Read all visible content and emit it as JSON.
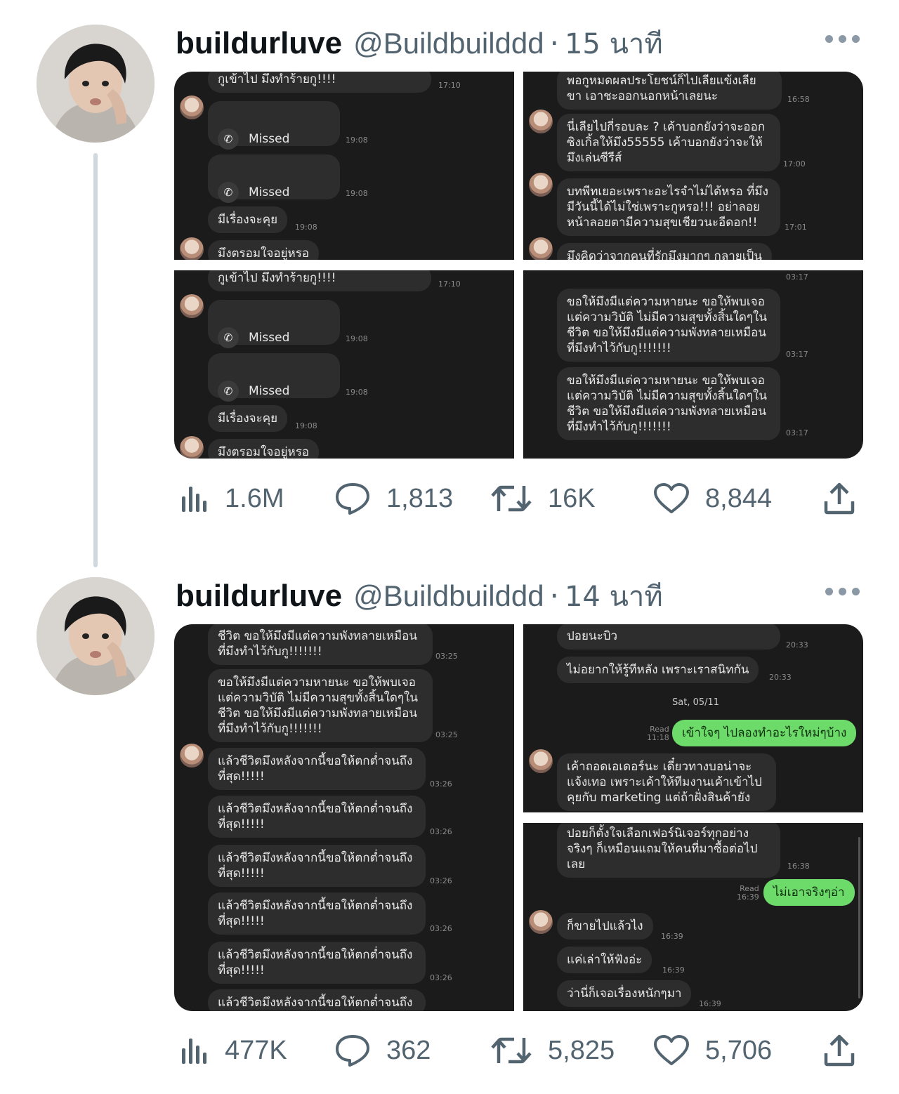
{
  "tweets": [
    {
      "name": "buildurluve",
      "handle": "@Buildbuilddd",
      "separator": "·",
      "time": "15 นาที",
      "avatar_icon": "profile-photo",
      "stats": {
        "views": "1.6M",
        "replies": "1,813",
        "retweets": "16K",
        "likes": "8,844"
      },
      "panels": {
        "top_left": {
          "bubble1": "กูเข้าไป มึงทำร้ายกู!!!!",
          "ts1": "17:10",
          "call1": "Missed",
          "ts2": "19:08",
          "call2": "Missed",
          "ts3": "19:08",
          "bubble2": "มีเรื่องจะคุย",
          "ts4": "19:08",
          "bubble3": "มึงตรอมใจอยู่หรอ"
        },
        "top_right": {
          "bubble1": "พอกูหมดผลประโยชน์ก็ไปเลียแข้งเลีย\nขา เอาชะออกนอกหน้าเลยนะ",
          "ts1": "16:58",
          "bubble2": "นี่เลียไปกี่รอบละ ? เค้าบอกยังว่าจะออก\nซิงเกิ้ลให้มึง55555 เค้าบอกยังว่าจะให้\nมึงเล่นซีรีส์",
          "ts2": "17:00",
          "bubble3": "บทพีทเยอะเพราะอะไรจำไม่ได้หรอ ที่มึง\nมีวันนี้ได้ไม่ใช่เพราะกูหรอ!!! อย่าลอย\nหน้าลอยตามีความสุขเชียวนะอีดอก!!",
          "ts3": "17:01",
          "bubble4": "มึงคิดว่าจากคนที่รักมึงมากๆ กลายเป็น"
        },
        "bottom_left": {
          "bubble1": "กูเข้าไป มึงทำร้ายกู!!!!",
          "ts1": "17:10",
          "call1": "Missed",
          "ts2": "19:08",
          "call2": "Missed",
          "ts3": "19:08",
          "bubble2": "มีเรื่องจะคุย",
          "ts4": "19:08",
          "bubble3": "มึงตรอมใจอยู่หรอ"
        },
        "bottom_right": {
          "ts0": "03:17",
          "bubble1": "ขอให้มึงมีแต่ความหายนะ ขอให้พบเจอ\nแต่ความวิบัติ ไม่มีความสุขทั้งสิ้นใดๆใน\nชีวิต ขอให้มึงมีแต่ความพังทลายเหมือน\nที่มึงทำไว้กับกู!!!!!!!",
          "ts1": "03:17",
          "bubble2": "ขอให้มึงมีแต่ความหายนะ ขอให้พบเจอ\nแต่ความวิบัติ ไม่มีความสุขทั้งสิ้นใดๆใน\nชีวิต ขอให้มึงมีแต่ความพังทลายเหมือน\nที่มึงทำไว้กับกู!!!!!!!",
          "ts2": "03:17"
        }
      }
    },
    {
      "name": "buildurluve",
      "handle": "@Buildbuilddd",
      "separator": "·",
      "time": "14 นาที",
      "avatar_icon": "profile-photo",
      "stats": {
        "views": "477K",
        "replies": "362",
        "retweets": "5,825",
        "likes": "5,706"
      },
      "panels": {
        "left": {
          "bubble1": "ชีวิต ขอให้มึงมีแต่ความพังทลายเหมือน\nที่มึงทำไว้กับกู!!!!!!!",
          "ts1": "03:25",
          "bubble2": "ขอให้มึงมีแต่ความหายนะ ขอให้พบเจอ\nแต่ความวิบัติ ไม่มีความสุขทั้งสิ้นใดๆใน\nชีวิต ขอให้มึงมีแต่ความพังทลายเหมือน\nที่มึงทำไว้กับกู!!!!!!!",
          "ts2": "03:25",
          "curse": "แล้วชีวิตมึงหลังจากนี้ขอให้ตกต่ำจนถึง\nที่สุด!!!!!",
          "ts_curse": "03:26",
          "last": "แล้วชีวิตมึงหลังจากนี้ขอให้ตกต่ำจนถึง"
        },
        "right_top": {
          "bubble1": "ปอยนะบิว",
          "ts1": "20:33",
          "bubble2": "ไม่อยากให้รู้ทีหลัง เพราะเราสนิทกัน",
          "ts2": "20:33",
          "date": "Sat, 05/11",
          "read": "Read\n11:18",
          "green1": "เข้าใจๆ ไปลองทำอะไรใหม่ๆบ้าง",
          "bubble3": "เค้าถอดเอเดอร์นะ เดี๋ยวทางบอน่าจะ\nแจ้งเทอ เพราะเค้าให้ทีมงานเค้าเข้าไป\nคุยกับ marketing แต่ถ้าฝั่งสินค้ายัง"
        },
        "right_bottom": {
          "bubble1": "ปอยก็ตั้งใจเลือกเฟอร์นิเจอร์ทุกอย่าง\nจริงๆ ก็เหมือนแถมให้คนที่มาซื้อต่อไป\nเลย",
          "ts1": "16:38",
          "read": "Read\n16:39",
          "green1": "ไม่เอาจริงๆอ่า",
          "bubble2": "ก็ขายไปแล้วไง",
          "ts2": "16:39",
          "bubble3": "แค่เล่าให้ฟังอ่ะ",
          "ts3": "16:39",
          "bubble4": "ว่านี่ก็เจอเรื่องหนักๆมา",
          "ts4": "16:39"
        }
      }
    }
  ],
  "colors": {
    "handle": "#536471",
    "green_bubble": "#6ddb6a",
    "panel_bg": "#1b1b1b",
    "bubble_bg": "#2d2d2d"
  }
}
